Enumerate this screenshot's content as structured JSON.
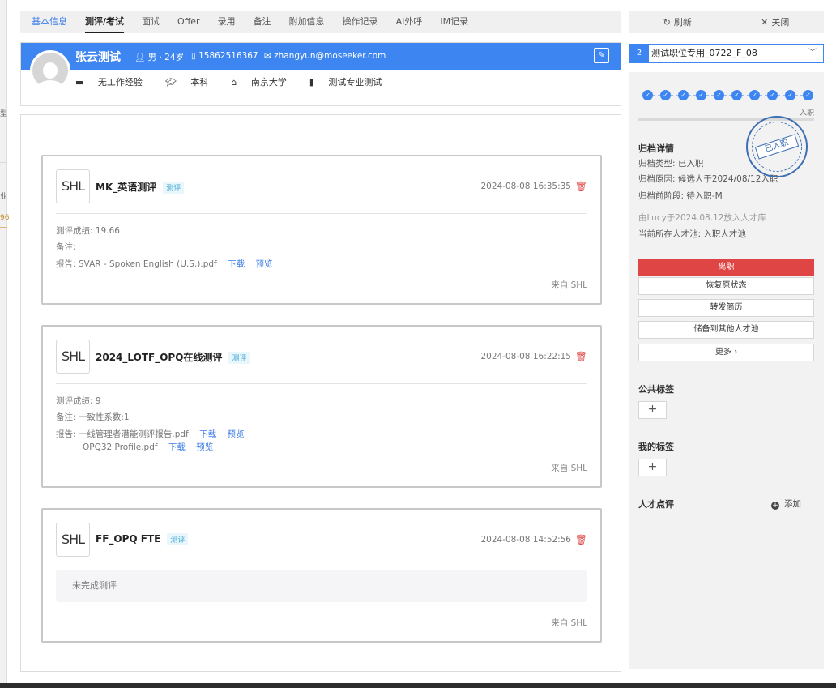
{
  "edge": {
    "text1": "型",
    "text2": "业",
    "text3": "96"
  },
  "tabs": [
    "基本信息",
    "测评/考试",
    "面试",
    "Offer",
    "录用",
    "备注",
    "附加信息",
    "操作记录",
    "AI外呼",
    "IM记录"
  ],
  "actions": {
    "refresh": "刷新",
    "close": "关闭"
  },
  "profile": {
    "name": "张云测试",
    "gender_age": "男 · 24岁",
    "phone": "15862516367",
    "email": "zhangyun@moseeker.com",
    "experience": "无工作经验",
    "degree": "本科",
    "school": "南京大学",
    "major": "测试专业测试"
  },
  "assessments": [
    {
      "logo": "SHL",
      "title": "MK_英语测评",
      "tag": "测评",
      "time": "2024-08-08 16:35:35",
      "score": "测评成绩: 19.66",
      "remark": "备注:",
      "report_prefix": "报告:",
      "report_file": "SVAR - Spoken English (U.S.).pdf",
      "download": "下载",
      "preview": "预览",
      "from": "来自 SHL"
    },
    {
      "logo": "SHL",
      "title": "2024_LOTF_OPQ在线测评",
      "tag": "测评",
      "time": "2024-08-08 16:22:15",
      "score": "测评成绩: 9",
      "remark": "备注: 一致性系数:1",
      "report_prefix": "报告:",
      "report_file": "一线管理者潜能测评报告.pdf",
      "report_file2": "OPQ32 Profile.pdf",
      "download": "下载",
      "preview": "预览",
      "from": "来自 SHL"
    },
    {
      "logo": "SHL",
      "title": "FF_OPQ FTE",
      "tag": "测评",
      "time": "2024-08-08 14:52:56",
      "pending": "未完成测评",
      "from": "来自 SHL"
    }
  ],
  "job": {
    "index": "2",
    "name": "测试职位专用_0722_F_08"
  },
  "progress": {
    "stage_label": "入职",
    "steps_completed": 10
  },
  "archive": {
    "title": "归档详情",
    "type": "归档类型: 已入职",
    "reason": "归档原因: 候选人于2024/08/12入职",
    "stage": "归档前阶段: 待入职-M",
    "stamp": "已入职",
    "by": "由Lucy于2024.08.12放入人才库",
    "pool": "当前所在人才池: 入职人才池"
  },
  "buttons": {
    "leave": "离职",
    "restore": "恢复原状态",
    "forward": "转发简历",
    "store": "储备到其他人才池",
    "more": "更多"
  },
  "public_tags": {
    "title": "公共标签"
  },
  "my_tags": {
    "title": "我的标签"
  },
  "review": {
    "title": "人才点评",
    "add": "添加"
  },
  "colors": {
    "primary": "#3d85f0",
    "danger": "#e04545",
    "tag_bg": "#e9f6fb",
    "tag_text": "#3aa6d2"
  }
}
